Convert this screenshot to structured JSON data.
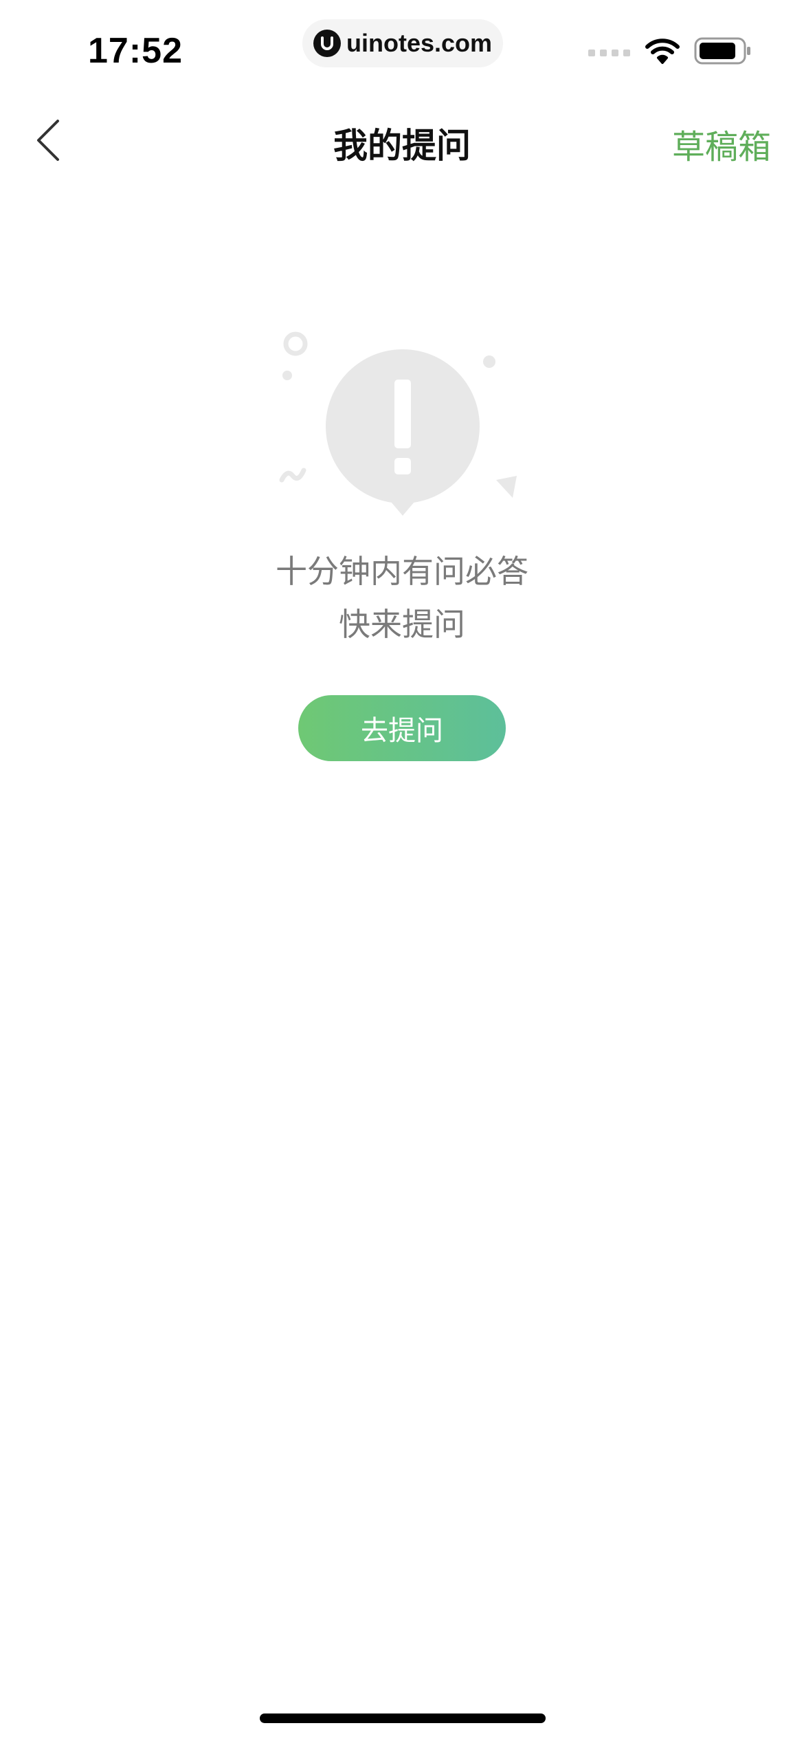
{
  "status_bar": {
    "time": "17:52",
    "url": "uinotes.com",
    "icons": [
      "signal-icon",
      "wifi-icon",
      "battery-icon"
    ]
  },
  "nav": {
    "back_icon": "chevron-left-icon",
    "title": "我的提问",
    "drafts_label": "草稿箱"
  },
  "empty_state": {
    "icon": "exclamation-speech-bubble-icon",
    "line1": "十分钟内有问必答",
    "line2": "快来提问",
    "button_label": "去提问"
  },
  "colors": {
    "accent": "#5fae5a",
    "button_gradient_start": "#6fc874",
    "button_gradient_end": "#5dbf9a",
    "illustration_gray": "#e8e8e8",
    "text_gray": "#7a7a7a"
  }
}
